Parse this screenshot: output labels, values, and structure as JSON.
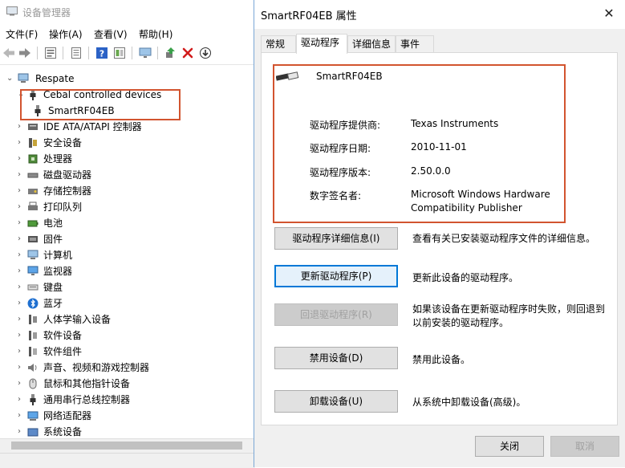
{
  "device_manager": {
    "title": "设备管理器",
    "menu": [
      "文件(F)",
      "操作(A)",
      "查看(V)",
      "帮助(H)"
    ],
    "toolbar_icons": [
      "back-arrow-icon",
      "forward-arrow-icon",
      "properties-icon",
      "show-hidden-icon",
      "help-icon",
      "view-icon",
      "monitor-icon",
      "update-driver-icon",
      "uninstall-x-icon",
      "download-icon"
    ],
    "root": "Respate",
    "tree": [
      {
        "label": "Cebal controlled devices",
        "expanded": true,
        "icon": "usb-plug-icon"
      },
      {
        "label": "SmartRF04EB",
        "child": true,
        "icon": "usb-plug-icon"
      },
      {
        "label": "IDE ATA/ATAPI 控制器",
        "icon": "ide-controller-icon"
      },
      {
        "label": "安全设备",
        "icon": "security-device-icon"
      },
      {
        "label": "处理器",
        "icon": "processor-icon"
      },
      {
        "label": "磁盘驱动器",
        "icon": "disk-drive-icon"
      },
      {
        "label": "存储控制器",
        "icon": "storage-controller-icon"
      },
      {
        "label": "打印队列",
        "icon": "printer-icon"
      },
      {
        "label": "电池",
        "icon": "battery-icon"
      },
      {
        "label": "固件",
        "icon": "firmware-icon"
      },
      {
        "label": "计算机",
        "icon": "computer-icon"
      },
      {
        "label": "监视器",
        "icon": "monitor-icon"
      },
      {
        "label": "键盘",
        "icon": "keyboard-icon"
      },
      {
        "label": "蓝牙",
        "icon": "bluetooth-icon"
      },
      {
        "label": "人体学输入设备",
        "icon": "hid-icon"
      },
      {
        "label": "软件设备",
        "icon": "software-device-icon"
      },
      {
        "label": "软件组件",
        "icon": "software-component-icon"
      },
      {
        "label": "声音、视频和游戏控制器",
        "icon": "speaker-icon"
      },
      {
        "label": "鼠标和其他指针设备",
        "icon": "mouse-icon"
      },
      {
        "label": "通用串行总线控制器",
        "icon": "usb-plug-icon"
      },
      {
        "label": "网络适配器",
        "icon": "network-adapter-icon"
      },
      {
        "label": "系统设备",
        "icon": "system-device-icon"
      }
    ]
  },
  "dialog": {
    "title": "SmartRF04EB 属性",
    "tabs": [
      "常规",
      "驱动程序",
      "详细信息",
      "事件"
    ],
    "active_tab": "驱动程序",
    "device_name": "SmartRF04EB",
    "info": {
      "provider_label": "驱动程序提供商:",
      "provider_value": "Texas Instruments",
      "date_label": "驱动程序日期:",
      "date_value": "2010-11-01",
      "version_label": "驱动程序版本:",
      "version_value": "2.50.0.0",
      "signer_label": "数字签名者:",
      "signer_value_line1": "Microsoft Windows Hardware",
      "signer_value_line2": "Compatibility Publisher"
    },
    "buttons": {
      "details_label": "驱动程序详细信息(I)",
      "details_desc": "查看有关已安装驱动程序文件的详细信息。",
      "update_label": "更新驱动程序(P)",
      "update_desc": "更新此设备的驱动程序。",
      "rollback_label": "回退驱动程序(R)",
      "rollback_desc": "如果该设备在更新驱动程序时失败，则回退到以前安装的驱动程序。",
      "disable_label": "禁用设备(D)",
      "disable_desc": "禁用此设备。",
      "uninstall_label": "卸载设备(U)",
      "uninstall_desc": "从系统中卸载设备(高级)。"
    },
    "footer": {
      "close_label": "关闭",
      "cancel_label": "取消"
    },
    "colors": {
      "highlight_box": "#d2542f",
      "focus_blue": "#0078d7"
    }
  }
}
